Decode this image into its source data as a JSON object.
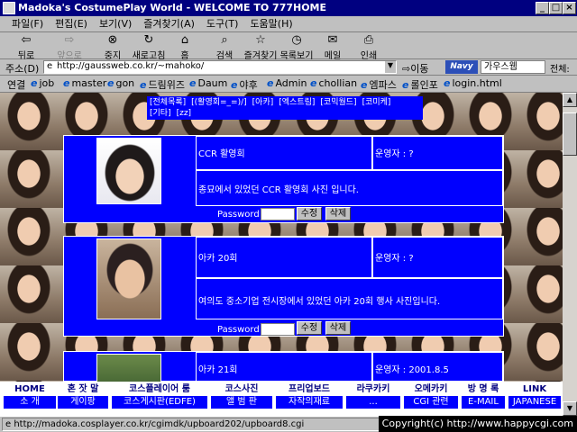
{
  "window": {
    "title": "Madoka's CostumePlay World - WELCOME TO 777HOME",
    "minimize": "_",
    "maximize": "□",
    "close": "×"
  },
  "menu": [
    "파일(F)",
    "편집(E)",
    "보기(V)",
    "즐겨찾기(A)",
    "도구(T)",
    "도움말(H)"
  ],
  "toolbar": {
    "back": "뒤로",
    "forward": "앞으로",
    "stop": "중지",
    "refresh": "새로고침",
    "home": "홈",
    "search": "검색",
    "favorites": "즐겨찾기",
    "history": "목록보기",
    "mail": "메일",
    "print": "인쇄"
  },
  "address": {
    "label": "주소(D)",
    "url": "http://gaussweb.co.kr/~mahoko/",
    "go": "이동",
    "brand": "Navy",
    "search_value": "가우스웹",
    "all": "전체:"
  },
  "links": {
    "label": "연결",
    "items": [
      "job",
      "master",
      "gon",
      "드림위즈",
      "Daum",
      "야후",
      "Admin",
      "chollian",
      "엠파스",
      "롤인포",
      "login.html"
    ]
  },
  "categories": [
    "[전체목록]",
    "[(활영회=_=)/]",
    "[아카]",
    "[엑스트림]",
    "[코믹월드]",
    "[코미케]",
    "[기타]",
    "[zz]"
  ],
  "cards": [
    {
      "title": "CCR 활영회",
      "operator": "운영자 : ?",
      "desc": "종묘에서 있었던 CCR 활영회 사진 입니다.",
      "pw_label": "Password",
      "edit": "수정",
      "delete": "삭제"
    },
    {
      "title": "아카 20회",
      "operator": "운영자 : ?",
      "desc": "여의도 중소기업 전시장에서 있었던 아카 20회 행사 사진입니다.",
      "pw_label": "Password",
      "edit": "수정",
      "delete": "삭제"
    },
    {
      "title": "아카 21회",
      "operator": "운영자 : 2001.8.5"
    }
  ],
  "nav": {
    "items": [
      "HOME",
      "혼 잣 말",
      "코스플레이어 룸",
      "코스사진",
      "프리업보드",
      "라쿠카키",
      "오메카키",
      "방 명 록",
      "LINK"
    ],
    "subs": [
      "소 개",
      "게이팡",
      "코스게시판(EDFE)",
      "앨 범 판",
      "자작의재료",
      "...",
      "CGI 관련",
      "E-MAIL",
      "JAPANESE"
    ]
  },
  "status": {
    "url": "http://madoka.cosplayer.co.kr/cgimdk/upboard202/upboard8.cgi",
    "copyright": "Copyright(c) http://www.happycgi.com"
  }
}
